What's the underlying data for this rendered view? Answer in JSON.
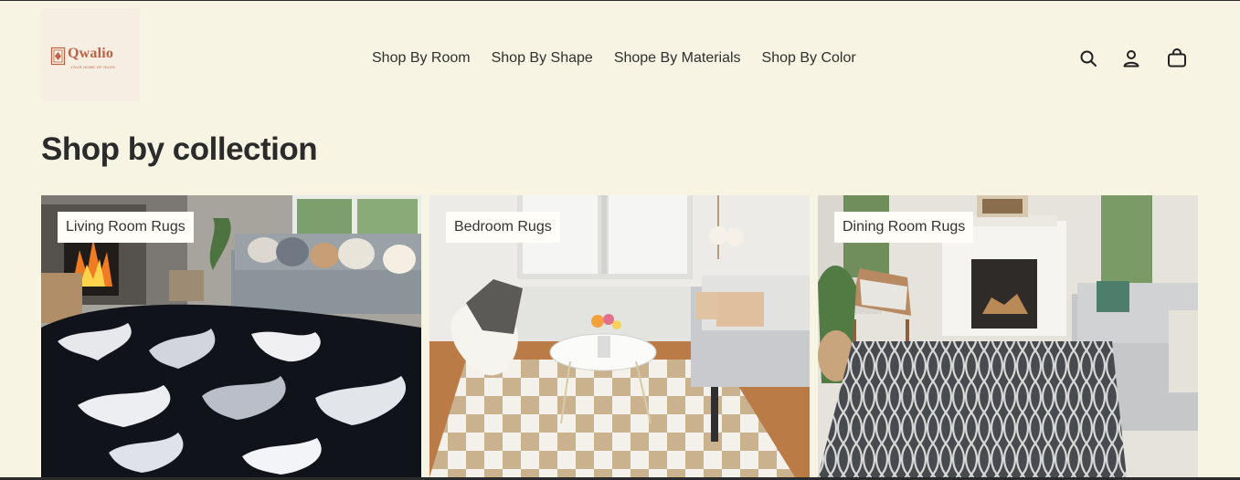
{
  "brand": {
    "name": "Qwalio",
    "tagline": "Your Home of Rugs",
    "color": "#c06141"
  },
  "nav": {
    "items": [
      {
        "label": "Shop By Room"
      },
      {
        "label": "Shop By Shape"
      },
      {
        "label": "Shope By Materials"
      },
      {
        "label": "Shop By Color"
      }
    ]
  },
  "header_icons": [
    "search-icon",
    "account-icon",
    "cart-icon"
  ],
  "main": {
    "title": "Shop by collection",
    "collections": [
      {
        "label": "Living Room Rugs"
      },
      {
        "label": "Bedroom Rugs"
      },
      {
        "label": "Dining Room Rugs"
      }
    ]
  },
  "colors": {
    "background": "#f8f4e4",
    "label_bg": "#fffdf8"
  }
}
